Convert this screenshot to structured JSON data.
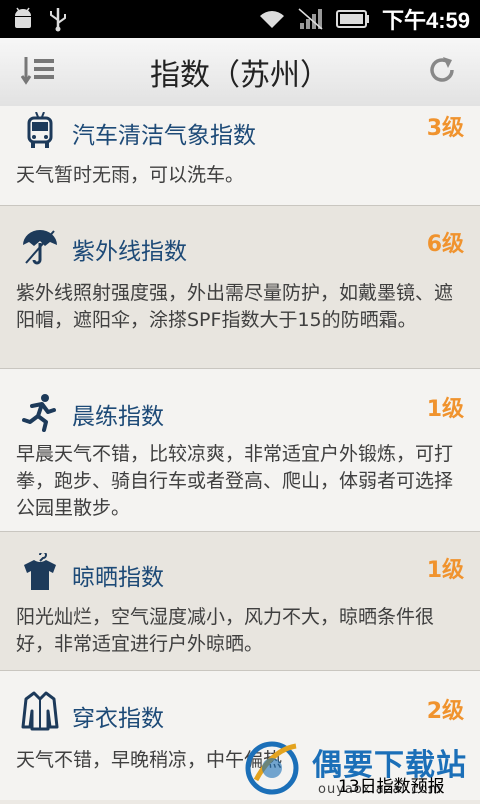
{
  "status_bar": {
    "time": "下午4:59",
    "icons": [
      "android-icon",
      "usb-icon",
      "wifi-icon",
      "signal-icon",
      "battery-icon"
    ]
  },
  "header": {
    "title": "指数（苏州）",
    "left_icon": "menu-icon",
    "right_icon": "refresh-icon"
  },
  "items": [
    {
      "icon": "car-icon",
      "name": "汽车清洁气象指数",
      "level": "3级",
      "desc": "天气暂时无雨，可以洗车。"
    },
    {
      "icon": "umbrella-icon",
      "name": "紫外线指数",
      "level": "6级",
      "desc": "紫外线照射强度强，外出需尽量防护，如戴墨镜、遮阳帽，遮阳伞，涂搽SPF指数大于15的防晒霜。"
    },
    {
      "icon": "runner-icon",
      "name": "晨练指数",
      "level": "1级",
      "desc": "早晨天气不错，比较凉爽，非常适宜户外锻炼，可打拳，跑步、骑自行车或者登高、爬山，体弱者可选择公园里散步。"
    },
    {
      "icon": "shirt-icon",
      "name": "晾晒指数",
      "level": "1级",
      "desc": "阳光灿烂，空气湿度减小，风力不大，晾晒条件很好，非常适宜进行户外晾晒。"
    },
    {
      "icon": "jacket-icon",
      "name": "穿衣指数",
      "level": "2级",
      "desc": "天气不错，早晚稍凉，中午偏热"
    }
  ],
  "footer": {
    "forecast_label": "13日指数预报",
    "watermark_text": "偶要下载站",
    "watermark_sub": "ouyaoxiazai.com"
  },
  "colors": {
    "accent": "#f0932e",
    "title_blue": "#1d4a77",
    "watermark_blue": "#1b6fb8"
  }
}
